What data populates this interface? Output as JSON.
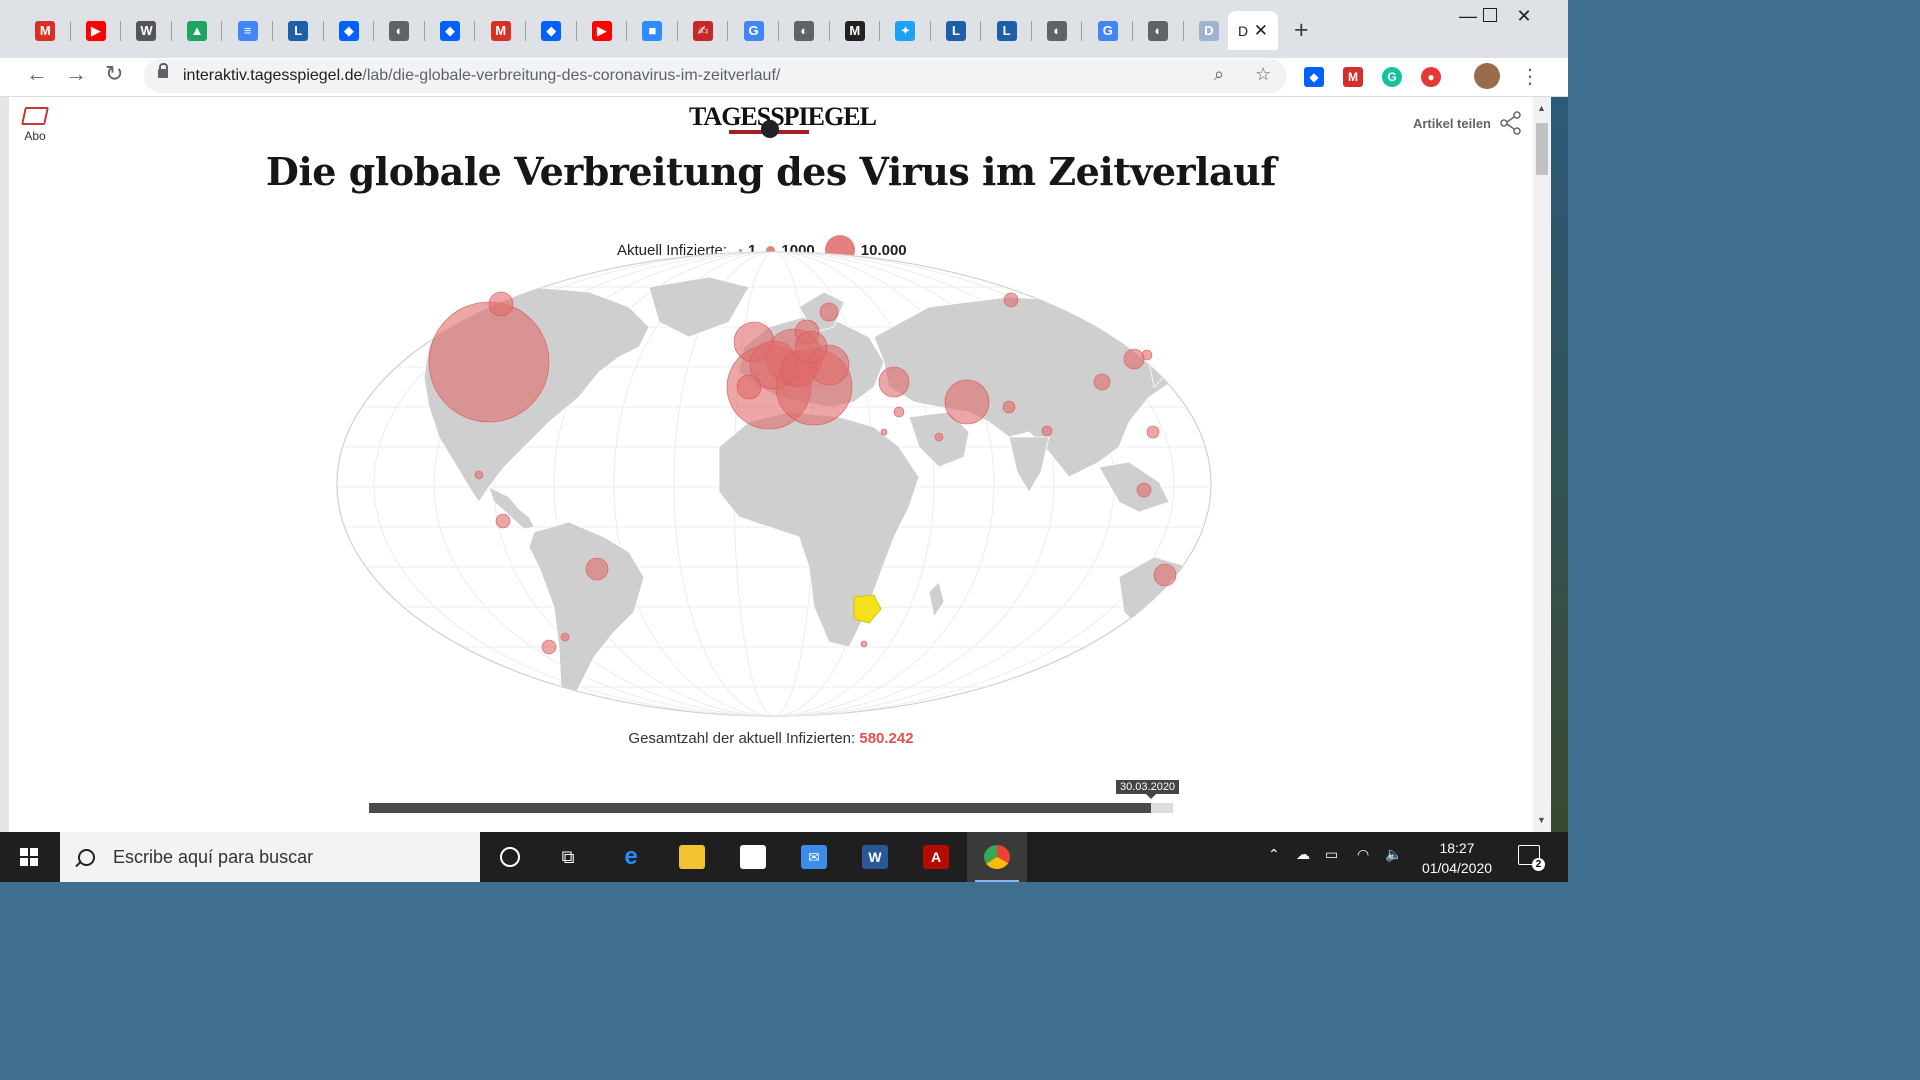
{
  "browser": {
    "tabs": [
      {
        "icon": "gmail-icon",
        "glyph": "M",
        "color": "#d93025"
      },
      {
        "icon": "youtube-icon",
        "glyph": "▶",
        "color": "#ff0000"
      },
      {
        "icon": "wikipedia-icon",
        "glyph": "W",
        "color": "#555555"
      },
      {
        "icon": "google-drive-icon",
        "glyph": "▲",
        "color": "#1fa463"
      },
      {
        "icon": "google-docs-icon",
        "glyph": "≡",
        "color": "#4285f4"
      },
      {
        "icon": "letter-l-icon",
        "glyph": "L",
        "color": "#1e5fa8"
      },
      {
        "icon": "dropbox-icon",
        "glyph": "◆",
        "color": "#0061fe"
      },
      {
        "icon": "globe-icon",
        "glyph": "◐",
        "color": "#5f6368"
      },
      {
        "icon": "dropbox-icon",
        "glyph": "◆",
        "color": "#0061fe"
      },
      {
        "icon": "gmail-icon",
        "glyph": "M",
        "color": "#d93025"
      },
      {
        "icon": "dropbox-icon",
        "glyph": "◆",
        "color": "#0061fe"
      },
      {
        "icon": "youtube-icon",
        "glyph": "▶",
        "color": "#ff0000"
      },
      {
        "icon": "zoom-icon",
        "glyph": "■",
        "color": "#2d8cff"
      },
      {
        "icon": "signature-icon",
        "glyph": "✍",
        "color": "#c62828"
      },
      {
        "icon": "google-icon",
        "glyph": "G",
        "color": "#4285f4"
      },
      {
        "icon": "globe-icon",
        "glyph": "◐",
        "color": "#5f6368"
      },
      {
        "icon": "medium-icon",
        "glyph": "M",
        "color": "#222222"
      },
      {
        "icon": "twitter-icon",
        "glyph": "✦",
        "color": "#1da1f2"
      },
      {
        "icon": "letter-l-icon",
        "glyph": "L",
        "color": "#1e5fa8"
      },
      {
        "icon": "letter-l-icon",
        "glyph": "L",
        "color": "#1e5fa8"
      },
      {
        "icon": "globe-icon",
        "glyph": "◐",
        "color": "#5f6368"
      },
      {
        "icon": "google-icon",
        "glyph": "G",
        "color": "#4285f4"
      },
      {
        "icon": "globe-icon",
        "glyph": "◐",
        "color": "#5f6368"
      },
      {
        "icon": "letter-d-icon",
        "glyph": "D",
        "color": "#9fb3d1"
      }
    ],
    "active_tab": {
      "label": "D",
      "icon": "close-icon"
    },
    "url_host": "interaktiv.tagesspiegel.de",
    "url_path": "/lab/die-globale-verbreitung-des-coronavirus-im-zeitverlauf/"
  },
  "page": {
    "abo_label": "Abo",
    "logo_text": "TAGESSPIEGEL",
    "share_label": "Artikel teilen",
    "title": "Die globale Verbreitung des Virus im Zeitverlauf",
    "legend": {
      "label": "Aktuell Infizierte:",
      "items": [
        "1",
        "1000",
        "10.000"
      ]
    },
    "total_label": "Gesamtzahl der aktuell Infizierten:",
    "total_value": "580.242",
    "slider_date": "30.03.2020",
    "slider_progress": 0.973,
    "colors": {
      "bubble": "#e06a6a",
      "highlight": "#f5e11a",
      "land": "#cfcfcf"
    }
  },
  "taskbar": {
    "search_placeholder": "Escribe aquí para buscar",
    "time": "18:27",
    "date": "01/04/2020",
    "notifications": "2"
  }
}
